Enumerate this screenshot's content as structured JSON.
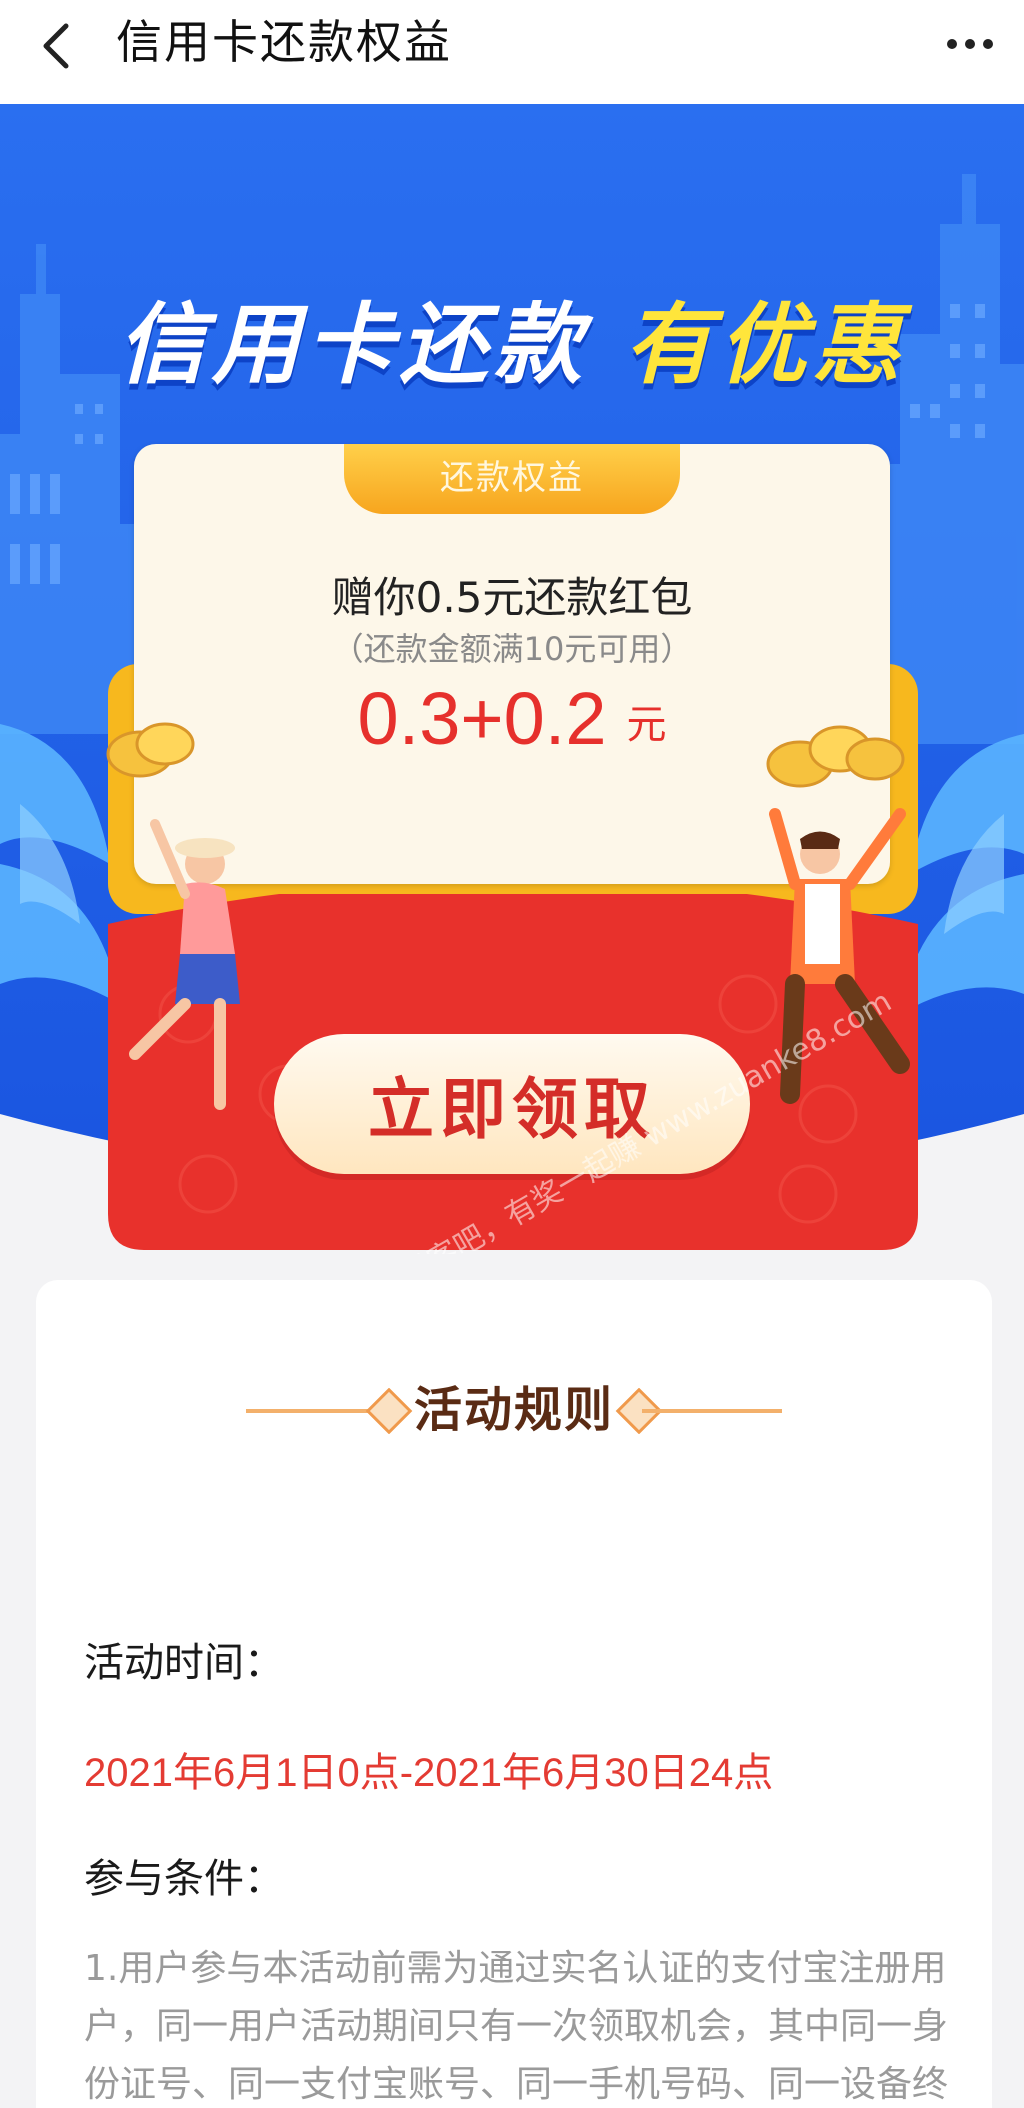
{
  "nav": {
    "title": "信用卡还款权益"
  },
  "hero": {
    "headline_white": "信用卡还款",
    "headline_yellow": "有优惠",
    "tab_label": "还款权益",
    "line1": "赠你0.5元还款红包",
    "line2": "（还款金额满10元可用）",
    "amount": "0.3+0.2",
    "unit": "元",
    "button_label": "立即领取",
    "watermark": "赚客吧，有奖一起赚 www.zuanke8.com"
  },
  "rules": {
    "title": "活动规则",
    "time_label": "活动时间：",
    "time_value": "2021年6月1日0点-2021年6月30日24点",
    "cond_label": "参与条件：",
    "cond_text": "1.用户参与本活动前需为通过实名认证的支付宝注册用户，同一用户活动期间只有一次领取机会，其中同一身份证号、同一支付宝账号、同一手机号码、同一设备终"
  },
  "colors": {
    "hero_blue": "#1f62ea",
    "red": "#e6302c",
    "gold": "#f7b81e",
    "brown": "#5a2b14"
  }
}
